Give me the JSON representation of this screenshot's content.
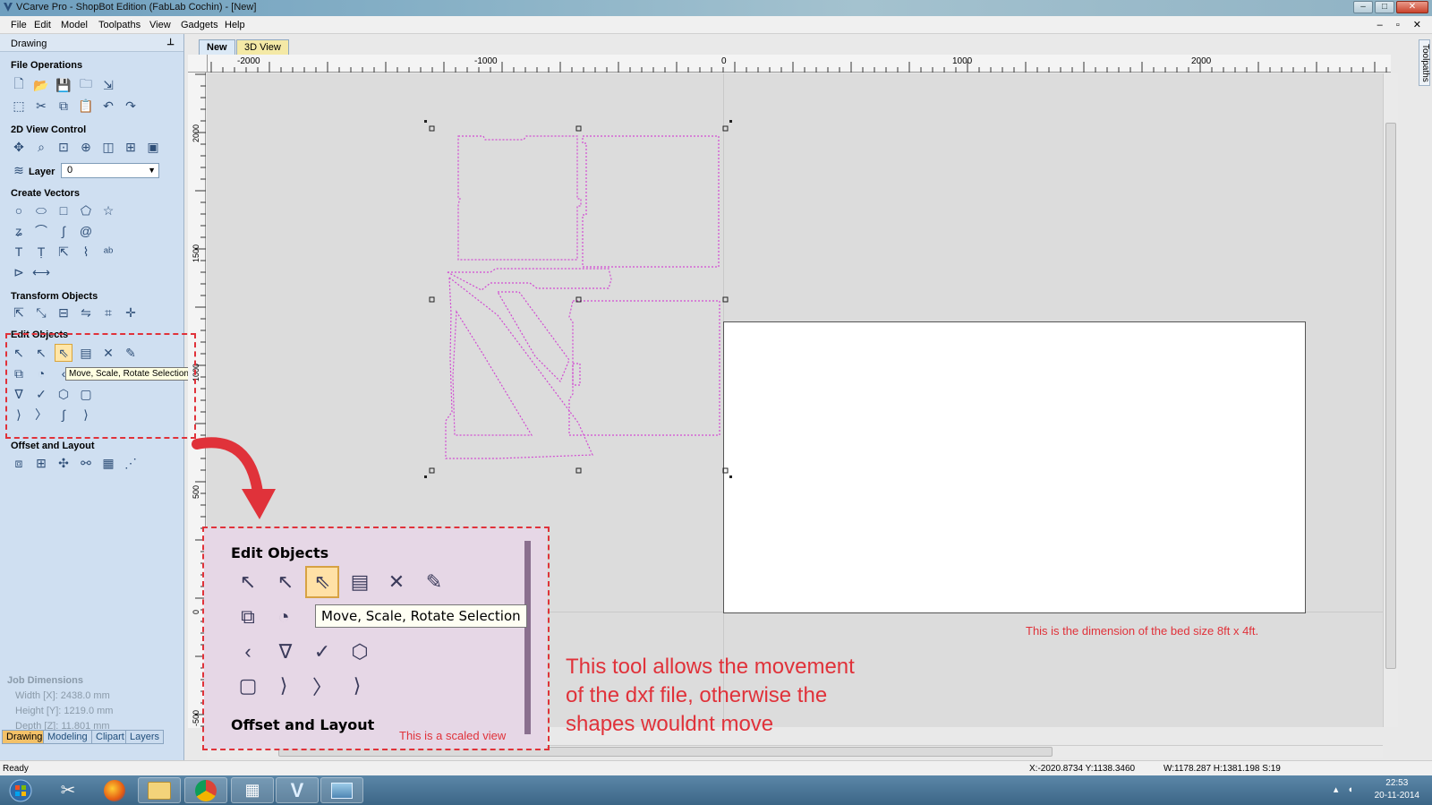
{
  "window": {
    "title": "VCarve Pro - ShopBot Edition (FabLab Cochin) - [New]",
    "controls": [
      "–",
      "□",
      "✕"
    ]
  },
  "menu": [
    "File",
    "Edit",
    "Model",
    "Toolpaths",
    "View",
    "Gadgets",
    "Help"
  ],
  "mdi_controls": "– ▫ ✕",
  "panel": {
    "title": "Drawing",
    "pin": "⊥",
    "sections": {
      "file_ops": "File Operations",
      "view_ctrl": "2D View Control",
      "create_vectors": "Create Vectors",
      "transform": "Transform Objects",
      "edit_objects": "Edit Objects",
      "offset_layout": "Offset and Layout"
    },
    "layer_label": "Layer",
    "layer_value": "0",
    "tooltip": "Move, Scale, Rotate Selection",
    "job_dims": {
      "heading": "Job Dimensions",
      "width": "Width  [X]: 2438.0 mm",
      "height": "Height [Y]: 1219.0 mm",
      "depth": "Depth  [Z]: 11.801 mm"
    },
    "bottom_tabs": [
      "Drawing",
      "Modeling",
      "Clipart",
      "Layers"
    ]
  },
  "doc_tabs": {
    "new": "New",
    "view3d": "3D View"
  },
  "side_tab": "Toolpaths",
  "ruler": {
    "h": [
      "-2000",
      "-1000",
      "0",
      "1000",
      "2000"
    ],
    "v": [
      "2000",
      "1500",
      "1000",
      "500",
      "0",
      "-500"
    ]
  },
  "status": {
    "ready": "Ready",
    "coords": "X:-2020.8734 Y:1138.3460",
    "size": "W:1178.287  H:1381.198  S:19"
  },
  "taskbar": {
    "time": "22:53",
    "date": "20-11-2014"
  },
  "zoom": {
    "title": "Edit Objects",
    "tooltip": "Move, Scale, Rotate Selection",
    "footer": "Offset and Layout",
    "note": "This is a scaled view"
  },
  "annotations": {
    "tool_note_1": "This tool allows the movement",
    "tool_note_2": "of the dxf file,  otherwise the",
    "tool_note_3": "shapes wouldnt move",
    "bed_note": "This is the dimension of the bed size 8ft x 4ft."
  },
  "colors": {
    "accent_red": "#e0323a",
    "vector_magenta": "#d14bd1",
    "panel_blue": "#cfdff1"
  },
  "icons": {
    "file": [
      "new-file-icon",
      "open-file-icon",
      "save-icon",
      "open-folder-icon",
      "import-icon",
      "select-all-icon",
      "cut-icon",
      "copy-icon",
      "paste-icon",
      "undo-icon",
      "redo-icon"
    ],
    "view": [
      "pan-icon",
      "zoom-icon",
      "zoom-extents-icon",
      "zoom-selection-icon",
      "view-split-icon",
      "view-grid-icon",
      "view-toggle-icon"
    ],
    "vectors": [
      "circle-icon",
      "ellipse-icon",
      "rectangle-icon",
      "polygon-icon",
      "star-icon",
      "polyline-icon",
      "arc-icon",
      "curve-icon",
      "spiral-icon",
      "text-icon",
      "text-on-curve-icon",
      "auto-layout-text-icon",
      "bend-text-icon",
      "text-style-icon",
      "dimension-icon",
      "measure-icon"
    ],
    "transform": [
      "move-icon",
      "scale-icon",
      "align-icon",
      "mirror-icon",
      "distort-icon",
      "center-icon"
    ],
    "edit": [
      "select-icon",
      "node-edit-icon",
      "move-scale-rotate-icon",
      "group-icon",
      "delete-icon",
      "trim-icon",
      "weld-icon",
      "subtract-icon",
      "smooth-icon",
      "fillet-icon",
      "node-icon",
      "fit-curve-icon",
      "join-icon",
      "close-icon",
      "extend-icon",
      "curve-icon",
      "arrow-icon"
    ],
    "offset": [
      "offset-icon",
      "array-icon",
      "nest-icon",
      "rotate-copy-icon",
      "grid-array-icon",
      "step-repeat-icon"
    ]
  }
}
